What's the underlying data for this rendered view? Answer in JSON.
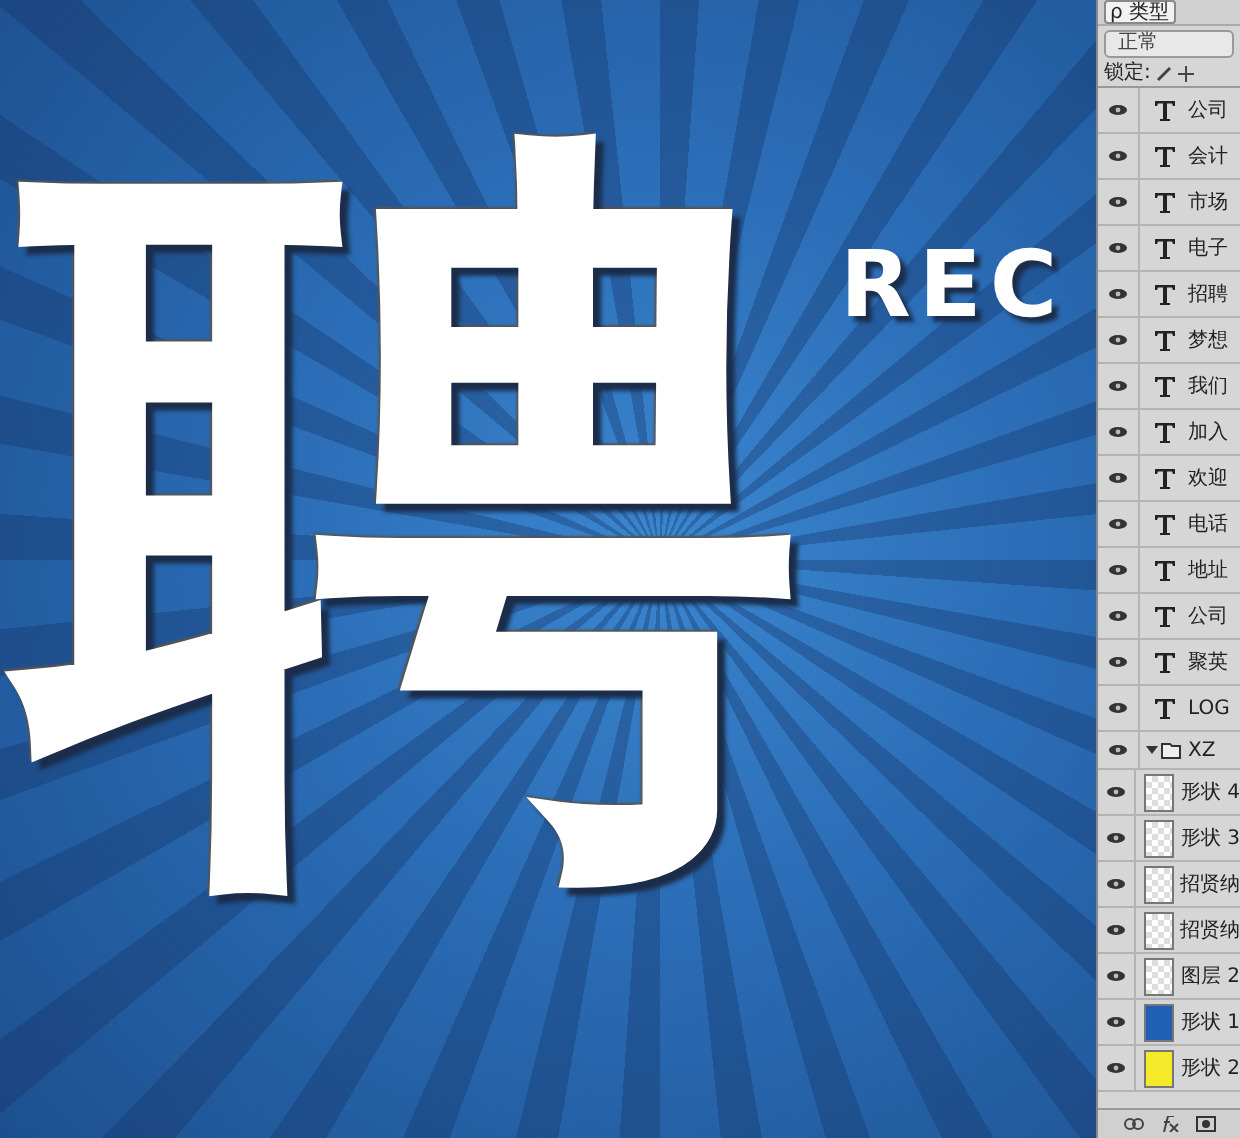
{
  "canvas": {
    "headline_char": "聘",
    "subtitle": "REC"
  },
  "layers_panel": {
    "filter": {
      "icon_char": "ρ",
      "label": "类型"
    },
    "blend_mode": "正常",
    "lock_label": "锁定:",
    "layers": [
      {
        "kind": "text",
        "name": "公司",
        "visible": true
      },
      {
        "kind": "text",
        "name": "会计",
        "visible": true
      },
      {
        "kind": "text",
        "name": "市场",
        "visible": true
      },
      {
        "kind": "text",
        "name": "电子",
        "visible": true
      },
      {
        "kind": "text",
        "name": "招聘",
        "visible": true
      },
      {
        "kind": "text",
        "name": "梦想",
        "visible": true
      },
      {
        "kind": "text",
        "name": "我们",
        "visible": true
      },
      {
        "kind": "text",
        "name": "加入",
        "visible": true
      },
      {
        "kind": "text",
        "name": "欢迎",
        "visible": true
      },
      {
        "kind": "text",
        "name": "电话",
        "visible": true
      },
      {
        "kind": "text",
        "name": "地址",
        "visible": true
      },
      {
        "kind": "text",
        "name": "公司",
        "visible": true
      },
      {
        "kind": "text",
        "name": "聚英",
        "visible": true
      },
      {
        "kind": "text",
        "name": "LOG",
        "visible": true
      },
      {
        "kind": "group",
        "name": "XZ",
        "visible": true,
        "expanded": true
      },
      {
        "kind": "shape",
        "name": "形状 4",
        "visible": true
      },
      {
        "kind": "shape",
        "name": "形状 3",
        "visible": true
      },
      {
        "kind": "pixel",
        "name": "招贤纳",
        "visible": true
      },
      {
        "kind": "pixel",
        "name": "招贤纳",
        "visible": true
      },
      {
        "kind": "pixel",
        "name": "图层 2",
        "visible": true
      },
      {
        "kind": "shape",
        "name": "形状 1",
        "visible": true,
        "color": "#1f5fb4"
      },
      {
        "kind": "shape",
        "name": "形状 2",
        "visible": true,
        "color": "#f4ea2a"
      }
    ]
  }
}
